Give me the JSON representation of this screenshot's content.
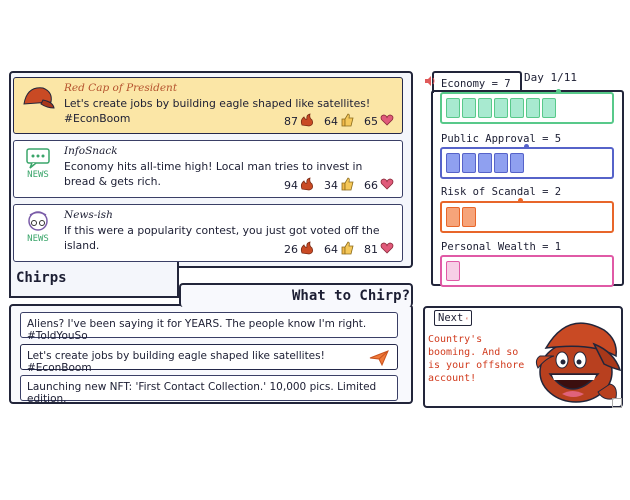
{
  "feed": {
    "title": "Chirps",
    "chirps": [
      {
        "author": "Red Cap of President",
        "text": "Let's create jobs by building eagle shaped like satellites! #EconBoom",
        "avatar": "red-cap-icon",
        "avatar_caption": "",
        "likes": "87",
        "thumbs": "64",
        "hearts": "65",
        "highlighted": true
      },
      {
        "author": "InfoSnack",
        "text": "Economy hits all-time high! Local man tries to invest in bread & gets rich.",
        "avatar": "news-chat-icon",
        "avatar_caption": "NEWS",
        "likes": "94",
        "thumbs": "34",
        "hearts": "66",
        "highlighted": false
      },
      {
        "author": "News-ish",
        "text": "If this were a popularity contest, you just got voted off the island.",
        "avatar": "news-glasses-icon",
        "avatar_caption": "NEWS",
        "likes": "26",
        "thumbs": "64",
        "hearts": "81",
        "highlighted": false
      }
    ]
  },
  "compose": {
    "title": "What to Chirp?",
    "options": [
      "Aliens? I've been saying it for YEARS. The people know I'm right. #ToldYouSo",
      "Let's create jobs by building eagle shaped like satellites! #EconBoom",
      "Launching new NFT: 'First Contact Collection.' 10,000 pics. Limited edition."
    ],
    "selected_index": 1
  },
  "stats": {
    "day": "Day 1/11",
    "meters": [
      {
        "label": "Economy = 7",
        "value": 7,
        "max": 11,
        "color": "#58c98a",
        "fill": "#a8ead0"
      },
      {
        "label": "Public Approval = 5",
        "value": 5,
        "max": 11,
        "color": "#5663c9",
        "fill": "#8fa0f0"
      },
      {
        "label": "Risk of Scandal = 2",
        "value": 2,
        "max": 11,
        "color": "#e8662a",
        "fill": "#f6a47a"
      },
      {
        "label": "Personal Wealth = 1",
        "value": 1,
        "max": 11,
        "color": "#e05aa6",
        "fill": "#f7cfe6"
      }
    ]
  },
  "advisor": {
    "next_label": "Next",
    "message": "Country's booming. And so is your offshore account!",
    "avatar": "red-cap-laughing-icon"
  },
  "colors": {
    "highlight": "#fbe6a6",
    "accent_red": "#d13b1e",
    "ink": "#22253a"
  }
}
